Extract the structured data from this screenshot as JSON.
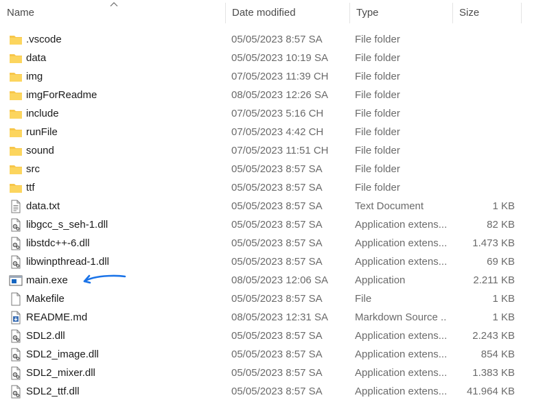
{
  "columns": {
    "name": "Name",
    "date_modified": "Date modified",
    "type": "Type",
    "size": "Size"
  },
  "files": [
    {
      "icon": "folder-icon",
      "name": ".vscode",
      "date": "05/05/2023 8:57 SA",
      "type": "File folder",
      "size": ""
    },
    {
      "icon": "folder-icon",
      "name": "data",
      "date": "05/05/2023 10:19 SA",
      "type": "File folder",
      "size": ""
    },
    {
      "icon": "folder-icon",
      "name": "img",
      "date": "07/05/2023 11:39 CH",
      "type": "File folder",
      "size": ""
    },
    {
      "icon": "folder-icon",
      "name": "imgForReadme",
      "date": "08/05/2023 12:26 SA",
      "type": "File folder",
      "size": ""
    },
    {
      "icon": "folder-icon",
      "name": "include",
      "date": "07/05/2023 5:16 CH",
      "type": "File folder",
      "size": ""
    },
    {
      "icon": "folder-icon",
      "name": "runFile",
      "date": "07/05/2023 4:42 CH",
      "type": "File folder",
      "size": ""
    },
    {
      "icon": "folder-icon",
      "name": "sound",
      "date": "07/05/2023 11:51 CH",
      "type": "File folder",
      "size": ""
    },
    {
      "icon": "folder-icon",
      "name": "src",
      "date": "05/05/2023 8:57 SA",
      "type": "File folder",
      "size": ""
    },
    {
      "icon": "folder-icon",
      "name": "ttf",
      "date": "05/05/2023 8:57 SA",
      "type": "File folder",
      "size": ""
    },
    {
      "icon": "text-file-icon",
      "name": "data.txt",
      "date": "05/05/2023 8:57 SA",
      "type": "Text Document",
      "size": "1 KB"
    },
    {
      "icon": "dll-file-icon",
      "name": "libgcc_s_seh-1.dll",
      "date": "05/05/2023 8:57 SA",
      "type": "Application extens...",
      "size": "82 KB"
    },
    {
      "icon": "dll-file-icon",
      "name": "libstdc++-6.dll",
      "date": "05/05/2023 8:57 SA",
      "type": "Application extens...",
      "size": "1.473 KB"
    },
    {
      "icon": "dll-file-icon",
      "name": "libwinpthread-1.dll",
      "date": "05/05/2023 8:57 SA",
      "type": "Application extens...",
      "size": "69 KB"
    },
    {
      "icon": "application-icon",
      "name": "main.exe",
      "date": "08/05/2023 12:06 SA",
      "type": "Application",
      "size": "2.211 KB"
    },
    {
      "icon": "blank-file-icon",
      "name": "Makefile",
      "date": "05/05/2023 8:57 SA",
      "type": "File",
      "size": "1 KB"
    },
    {
      "icon": "markdown-file-icon",
      "name": "README.md",
      "date": "08/05/2023 12:31 SA",
      "type": "Markdown Source ...",
      "size": "1 KB"
    },
    {
      "icon": "dll-file-icon",
      "name": "SDL2.dll",
      "date": "05/05/2023 8:57 SA",
      "type": "Application extens...",
      "size": "2.243 KB"
    },
    {
      "icon": "dll-file-icon",
      "name": "SDL2_image.dll",
      "date": "05/05/2023 8:57 SA",
      "type": "Application extens...",
      "size": "854 KB"
    },
    {
      "icon": "dll-file-icon",
      "name": "SDL2_mixer.dll",
      "date": "05/05/2023 8:57 SA",
      "type": "Application extens...",
      "size": "1.383 KB"
    },
    {
      "icon": "dll-file-icon",
      "name": "SDL2_ttf.dll",
      "date": "05/05/2023 8:57 SA",
      "type": "Application extens...",
      "size": "41.964 KB"
    }
  ],
  "colors": {
    "folder": "#f7c64a",
    "annotation_arrow": "#1a73e8",
    "application_icon": "#1565c0"
  }
}
